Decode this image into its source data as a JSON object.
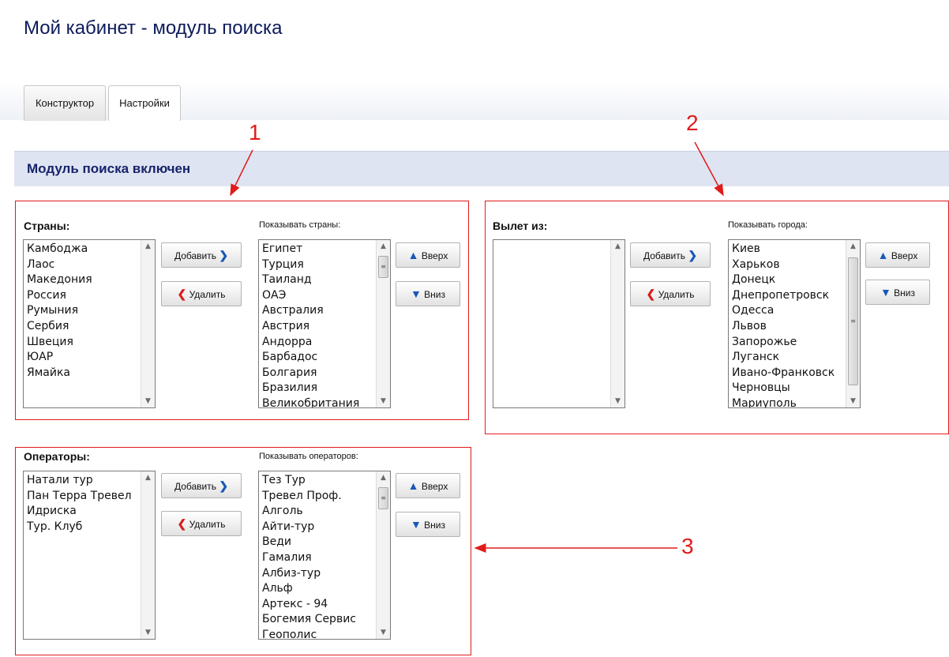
{
  "page": {
    "title": "Мой кабинет - модуль поиска"
  },
  "tabs": [
    {
      "label": "Конструктор"
    },
    {
      "label": "Настройки"
    }
  ],
  "status": {
    "text": "Модуль поиска включен"
  },
  "countries": {
    "label": "Страны:",
    "show_label": "Показывать страны:",
    "available": [
      "Камбоджа",
      "Лаос",
      "Македония",
      "Россия",
      "Румыния",
      "Сербия",
      "Швеция",
      "ЮАР",
      "Ямайка"
    ],
    "shown": [
      "Египет",
      "Турция",
      "Таиланд",
      "ОАЭ",
      "Австралия",
      "Австрия",
      "Андорра",
      "Барбадос",
      "Болгария",
      "Бразилия",
      "Великобритания"
    ]
  },
  "departure": {
    "label": "Вылет из:",
    "show_label": "Показывать города:",
    "available": [],
    "shown": [
      "Киев",
      "Харьков",
      "Донецк",
      "Днепропетровск",
      "Одесса",
      "Львов",
      "Запорожье",
      "Луганск",
      "Ивано-Франковск",
      "Черновцы",
      "Мариуполь"
    ]
  },
  "operators": {
    "label": "Операторы:",
    "show_label": "Показывать операторов:",
    "available": [
      "Натали тур",
      "Пан Терра Тревел",
      "Идриска",
      "Тур. Клуб"
    ],
    "shown": [
      "Тез Тур",
      "Тревел Проф.",
      "Алголь",
      "Айти-тур",
      "Веди",
      "Гамалия",
      "Албиз-тур",
      "Альф",
      "Артекс - 94",
      "Богемия Сервис",
      "Геополис"
    ]
  },
  "buttons": {
    "add": "Добавить",
    "remove": "Удалить",
    "up": "Вверх",
    "down": "Вниз"
  },
  "icons": {
    "add": "chevron-right-icon",
    "remove": "chevron-left-icon",
    "up": "chevron-up-icon",
    "down": "chevron-down-icon"
  },
  "colors": {
    "annotation": "#e11b1b",
    "title": "#0d1b5a",
    "accent": "#1a57b8"
  },
  "callouts": [
    "1",
    "2",
    "3"
  ]
}
